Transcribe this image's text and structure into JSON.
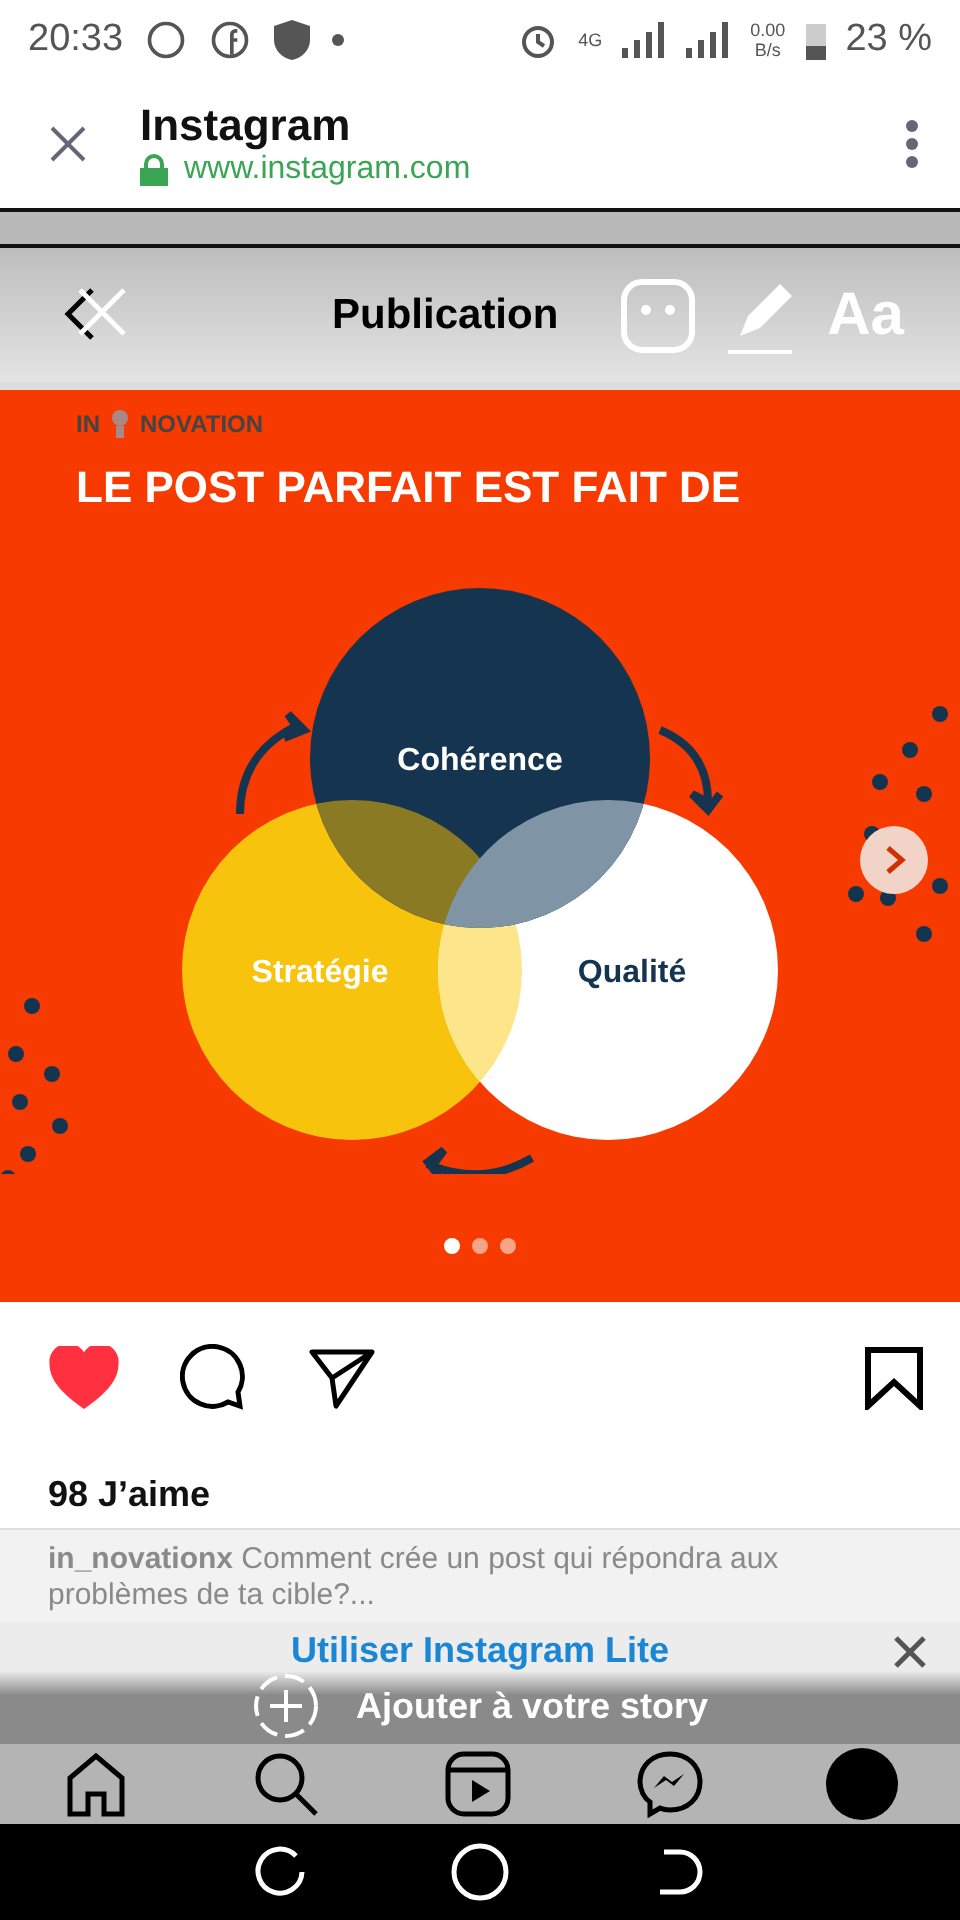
{
  "status_bar": {
    "time": "20:33",
    "network": "4G",
    "speed_value": "0.00",
    "speed_unit": "B/s",
    "battery": "23 %"
  },
  "browser": {
    "title": "Instagram",
    "url": "www.instagram.com"
  },
  "story_editor": {
    "title": "Publication",
    "text_tool": "Aa"
  },
  "post": {
    "logo": [
      "IN",
      "NOVATION"
    ],
    "headline": "LE POST PARFAIT EST FAIT DE",
    "circles": [
      {
        "label": "Cohérence"
      },
      {
        "label": "Stratégie"
      },
      {
        "label": "Qualité"
      }
    ],
    "slides": [
      {
        "selected": true
      },
      {
        "selected": false
      },
      {
        "selected": false
      }
    ],
    "liked": true,
    "likes": "98 J’aime",
    "caption": "**in_novationx** Comment crée un post qui répondra aux problèmes de ta cible?..."
  },
  "banner": {
    "title": "Utiliser Instagram Lite",
    "story_label": "Ajouter à votre story"
  }
}
